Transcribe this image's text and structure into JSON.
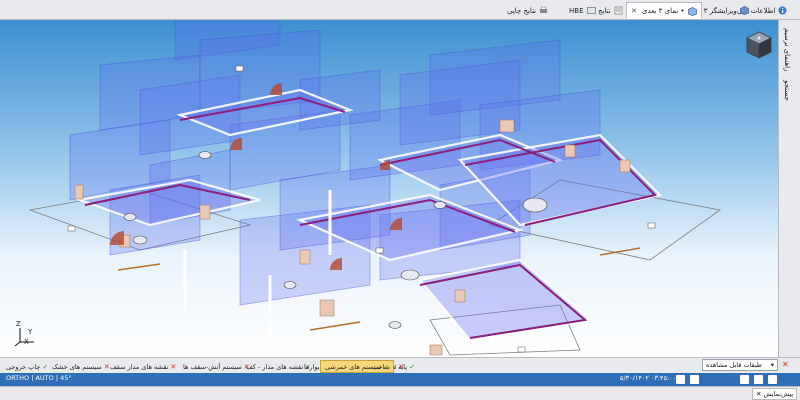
{
  "top_tabs": [
    {
      "label": "اطلاعات کلی",
      "icon": "info-icon"
    },
    {
      "label": "ویرایشگر ۳ بعدی",
      "icon": "cube-edit-icon",
      "closable": true
    },
    {
      "label": "• نمای ۳ بعدی",
      "icon": "view3d-icon",
      "closable": true,
      "active": true
    },
    {
      "label": "نتایج",
      "icon": "results-icon"
    },
    {
      "label": "HBE",
      "icon": "hbe-icon"
    },
    {
      "label": "نتایج چاپی",
      "icon": "print-results-icon"
    }
  ],
  "side_panel": {
    "tab1": "راهنمای ترسیم",
    "tab2": "جستجو"
  },
  "view_tabs": [
    {
      "label": "چاپ خروجی",
      "mark": "✓"
    },
    {
      "label": "سیستم های خشک",
      "mark": "✕"
    },
    {
      "label": "نقشه های مدار سقف",
      "mark": "✕"
    },
    {
      "label": "سیستم آتش-سقف ها",
      "mark": "✕"
    },
    {
      "label": "نقشه های مدار - کف",
      "mark": "✓"
    },
    {
      "label": "سیستم های آتش - کف ها، دیوارها",
      "mark": "✕"
    },
    {
      "label": "سیستم های خمرشی",
      "mark": "✓",
      "active": true
    },
    {
      "label": "ساخت",
      "mark": "✓"
    },
    {
      "label": "پایه",
      "mark": "✓"
    }
  ],
  "presets_dropdown": {
    "label": "طبقات قابل مشاهده"
  },
  "status": {
    "left": "ORTHO | AUTO | 45°",
    "datetime": "۵/۳۰/۱۴۰۲ ۰۳:۴۵:۰۰",
    "coords": ""
  },
  "bottom_panel": {
    "tab_label": "پیش‌نمایش"
  },
  "axis_labels": {
    "x": "X",
    "y": "Y",
    "z": "Z"
  },
  "colors": {
    "sky_top": "#3d8fd0",
    "sky_bottom": "#ffffff",
    "room_fill": "#5a6cf0",
    "pipe": "#8b1f7a",
    "wall_line": "#ffffff",
    "active_tab": "#f6d77a",
    "status_bar": "#2e6fb7",
    "door_arc": "#b5492f"
  }
}
